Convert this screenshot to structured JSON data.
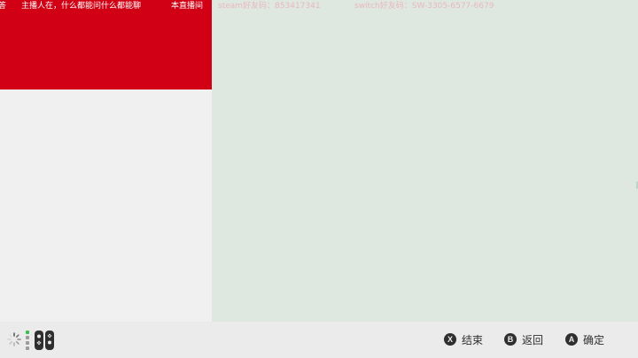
{
  "marquee": {
    "segments": [
      "答",
      "主播人在，什么都能问什么都能聊",
      "本直播间",
      "steam好友码：853417341",
      "switch好友码：SW-3305-6577-6679"
    ]
  },
  "footer": {
    "hints": [
      {
        "glyph": "X",
        "label": "结束"
      },
      {
        "glyph": "B",
        "label": "返回"
      },
      {
        "glyph": "A",
        "label": "确定"
      }
    ]
  },
  "colors": {
    "banner_red": "#d10014",
    "left_panel": "#f0f0f0",
    "right_panel": "#dfe7e1",
    "footer_bg": "#ebebeb",
    "accent_green": "#39c24a"
  },
  "icons": {
    "loading": "spinner-icon",
    "controller": "joycon-icon"
  }
}
